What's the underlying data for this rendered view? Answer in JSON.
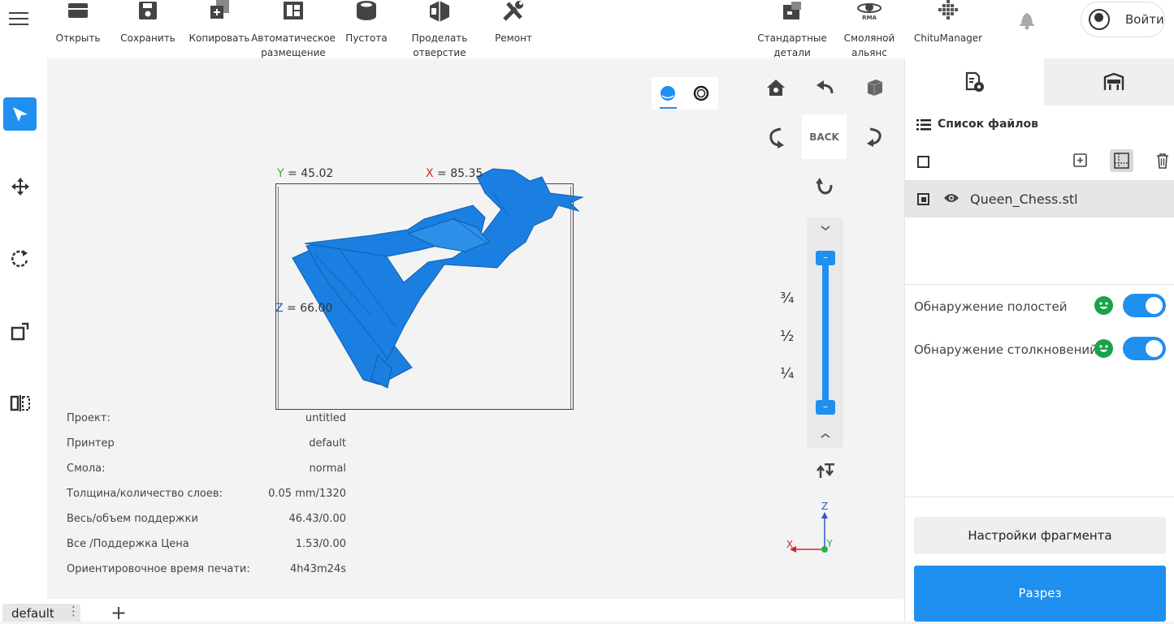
{
  "toolbar": {
    "items": [
      {
        "label": "Открыть",
        "icon": "folder-icon"
      },
      {
        "label": "Сохранить",
        "icon": "save-icon"
      },
      {
        "label": "Копировать",
        "icon": "copy-icon"
      },
      {
        "label": "Автоматическое\nразмещение",
        "icon": "auto-layout-icon"
      },
      {
        "label": "Пустота",
        "icon": "hollow-icon"
      },
      {
        "label": "Проделать\nотверстие",
        "icon": "punch-hole-icon"
      },
      {
        "label": "Ремонт",
        "icon": "repair-icon"
      },
      {
        "label": "Стандартные\nдетали",
        "icon": "standard-parts-icon"
      },
      {
        "label": "Смоляной\nальянс",
        "icon": "rma-icon",
        "icon_text": "RMA"
      },
      {
        "label": "ChituManager",
        "icon": "chitu-manager-icon"
      }
    ],
    "login_label": "Войти"
  },
  "left_tools": [
    {
      "icon": "select-arrow-icon",
      "active": true
    },
    {
      "icon": "move-icon",
      "active": false
    },
    {
      "icon": "rotate-icon",
      "active": false
    },
    {
      "icon": "scale-icon",
      "active": false
    },
    {
      "icon": "mirror-icon",
      "active": false
    }
  ],
  "viewport": {
    "dims": {
      "y_label": "Y",
      "y_value": "= 45.02",
      "x_label": "X",
      "x_value": "= 85.35",
      "z_label": "Z",
      "z_value": "= 66.00"
    },
    "view_back_label": "BACK",
    "layer_fractions": [
      "¾",
      "½",
      "¼"
    ],
    "axis_labels": {
      "x": "X",
      "y": "Y",
      "z": "Z"
    },
    "info": [
      {
        "key": "Проект:",
        "value": "untitled"
      },
      {
        "key": "Принтер",
        "value": "default"
      },
      {
        "key": "Смола:",
        "value": "normal"
      },
      {
        "key": "Толщина/количество слоев:",
        "value": "0.05 mm/1320"
      },
      {
        "key": "Весь/объем поддержки",
        "value": "46.43/0.00"
      },
      {
        "key": "Все /Поддержка Цена",
        "value": "1.53/0.00"
      },
      {
        "key": "Ориентировочное время печати:",
        "value": "4h43m24s"
      }
    ]
  },
  "right_panel": {
    "file_list_title": "Список файлов",
    "files": [
      {
        "name": "Queen_Chess.stl"
      }
    ],
    "options": [
      {
        "label": "Обнаружение полостей",
        "enabled": true
      },
      {
        "label": "Обнаружение столкновений",
        "enabled": true
      }
    ],
    "settings_button": "Настройки фрагмента",
    "slice_button": "Разрез"
  },
  "bottom": {
    "tab_label": "default",
    "tab_menu": "⋮",
    "add_tab": "+"
  },
  "colors": {
    "accent": "#1f8ff0",
    "model": "#1a7fe0",
    "ok_green": "#1aa34a"
  }
}
